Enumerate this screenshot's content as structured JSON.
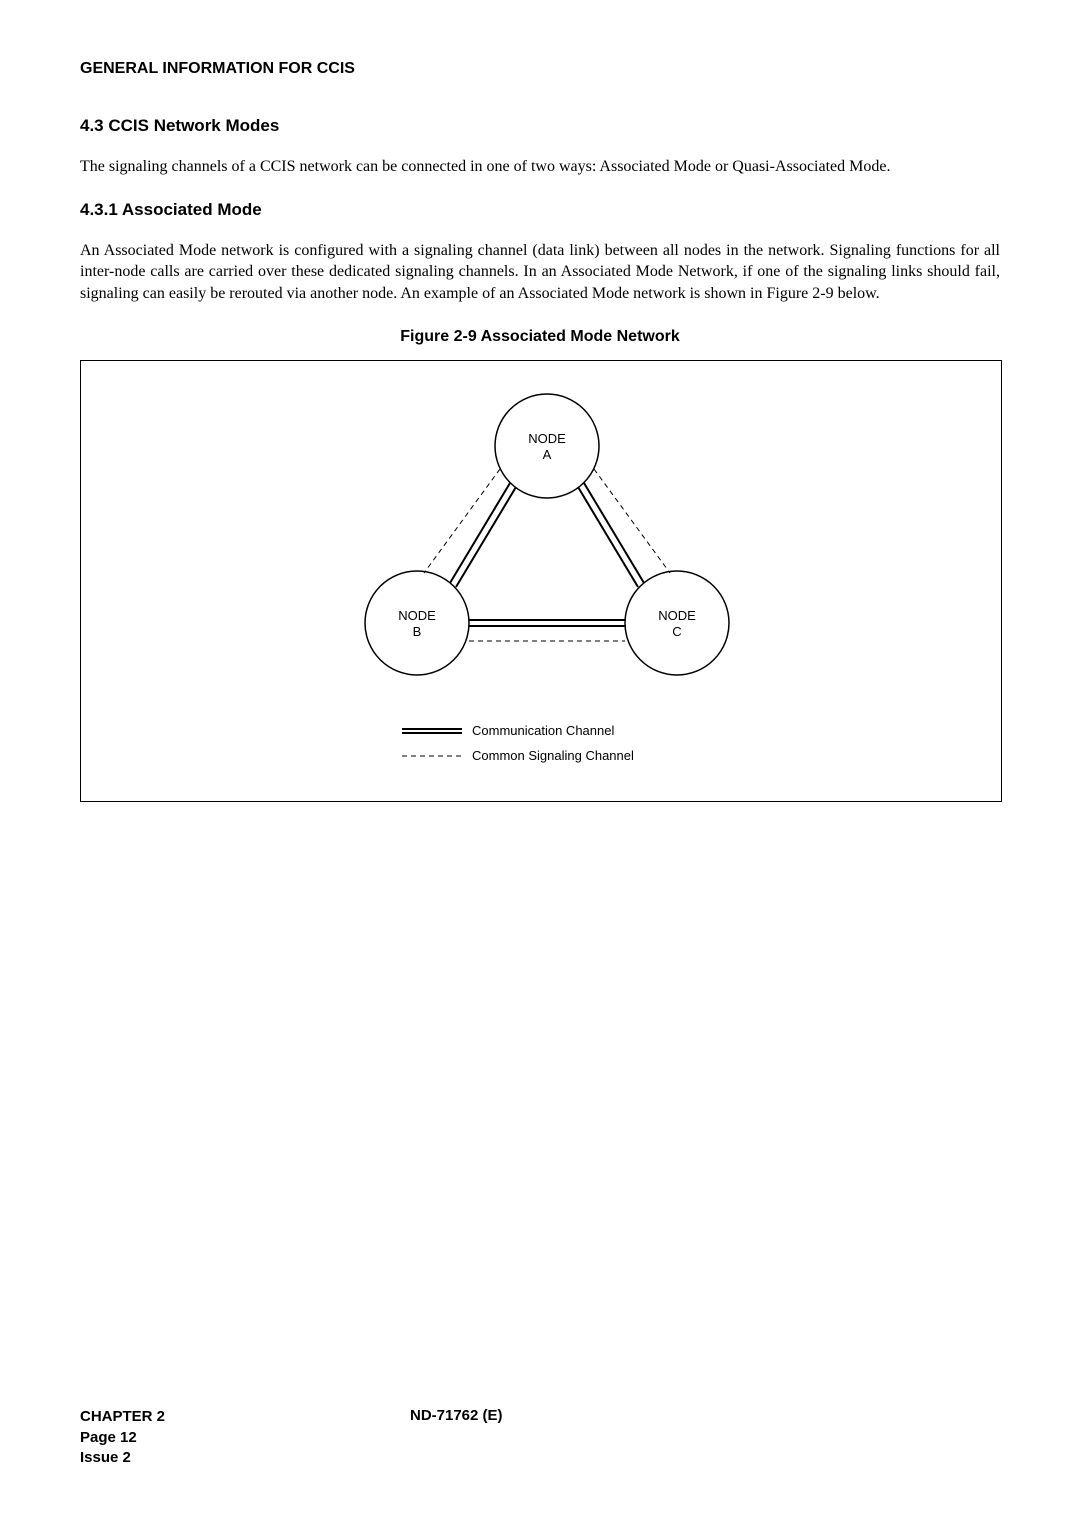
{
  "header": "GENERAL INFORMATION FOR CCIS",
  "section_4_3": {
    "heading": "4.3   CCIS Network Modes",
    "paragraph": "The signaling channels of a CCIS network can be connected in one of two ways: Associated Mode or Quasi-Associated Mode."
  },
  "section_4_3_1": {
    "heading": "4.3.1   Associated Mode",
    "paragraph": "An Associated Mode network is configured with a signaling channel (data link) between all nodes in the network. Signaling functions for all inter-node calls are carried over these dedicated signaling channels. In an Associated Mode Network, if one of the signaling links should fail, signaling can easily be rerouted via another node. An example of an Associated Mode network is shown in Figure 2-9 below."
  },
  "figure": {
    "title": "Figure 2-9   Associated Mode Network",
    "node_a": {
      "label1": "NODE",
      "label2": "A"
    },
    "node_b": {
      "label1": "NODE",
      "label2": "B"
    },
    "node_c": {
      "label1": "NODE",
      "label2": "C"
    },
    "legend": {
      "comm_channel": "Communication Channel",
      "signaling_channel": "Common Signaling Channel"
    }
  },
  "footer": {
    "chapter": "CHAPTER 2",
    "page": "Page 12",
    "issue": "Issue 2",
    "doc_id": "ND-71762 (E)"
  }
}
